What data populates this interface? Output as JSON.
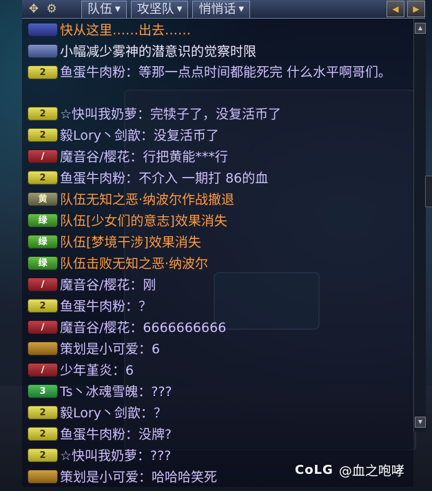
{
  "toolbar": {
    "move_icon": "move-arrows-icon",
    "settings_icon": "gear-icon",
    "tabs": [
      {
        "label": "队伍"
      },
      {
        "label": "攻坚队"
      },
      {
        "label": "悄悄话"
      }
    ],
    "prev_icon": "triangle-left-icon",
    "next_icon": "triangle-right-icon"
  },
  "messages": [
    {
      "badge": "",
      "badge_type": "blue",
      "text": "快从这里……出去……",
      "color": "orange"
    },
    {
      "badge": "",
      "badge_type": "info",
      "text": "小幅减少雾神的潜意识的觉察时限",
      "color": "white"
    },
    {
      "badge": "2",
      "badge_type": "gold",
      "text": "鱼蛋牛肉粉：等那一点点时间都能死完 什么水平啊哥们｡",
      "color": "purple"
    },
    {
      "badge": "2",
      "badge_type": "gold",
      "text": "☆快叫我奶萝：完犊子了，没复活币了",
      "color": "purple"
    },
    {
      "badge": "2",
      "badge_type": "gold",
      "text": "毅Lory丶剑歆：没复活币了",
      "color": "purple"
    },
    {
      "badge": "/",
      "badge_type": "red",
      "text": "魔音谷/樱花：行把黄能***行",
      "color": "purple"
    },
    {
      "badge": "2",
      "badge_type": "gold",
      "text": "鱼蛋牛肉粉：不介入 一期打 86的血",
      "color": "purple"
    },
    {
      "badge": "黄",
      "badge_type": "sys",
      "text": "队伍无知之恶·纳波尔作战撤退",
      "color": "orange"
    },
    {
      "badge": "绿",
      "badge_type": "green",
      "text": "队伍[少女们的意志]效果消失",
      "color": "orange"
    },
    {
      "badge": "绿",
      "badge_type": "green",
      "text": "队伍[梦境干涉]效果消失",
      "color": "orange"
    },
    {
      "badge": "绿",
      "badge_type": "green",
      "text": "队伍击败无知之恶·纳波尔",
      "color": "orange"
    },
    {
      "badge": "/",
      "badge_type": "red",
      "text": "魔音谷/樱花：刚",
      "color": "purple"
    },
    {
      "badge": "2",
      "badge_type": "gold",
      "text": "鱼蛋牛肉粉：？",
      "color": "purple"
    },
    {
      "badge": "/",
      "badge_type": "red",
      "text": "魔音谷/樱花：6666666666",
      "color": "purple"
    },
    {
      "badge": "",
      "badge_type": "gm",
      "text": "策划是小可爱：6",
      "color": "purple"
    },
    {
      "badge": "/",
      "badge_type": "red",
      "text": "少年堇炎：6",
      "color": "purple"
    },
    {
      "badge": "3",
      "badge_type": "lv3",
      "text": "Ts丶冰魂雪魄：???",
      "color": "purple"
    },
    {
      "badge": "2",
      "badge_type": "gold",
      "text": "毅Lory丶剑歆：？",
      "color": "purple"
    },
    {
      "badge": "2",
      "badge_type": "gold",
      "text": "鱼蛋牛肉粉：没牌?",
      "color": "purple"
    },
    {
      "badge": "2",
      "badge_type": "gold",
      "text": "☆快叫我奶萝：???",
      "color": "purple"
    },
    {
      "badge": "",
      "badge_type": "gm",
      "text": "策划是小可爱：哈哈哈笑死",
      "color": "purple"
    }
  ],
  "watermark": {
    "logo": "CoLG",
    "handle": "@血之咆哮"
  },
  "colors": {
    "purple_text": "#d0c0ff",
    "orange_text": "#ff9a40",
    "white_text": "#f0e8ff"
  }
}
